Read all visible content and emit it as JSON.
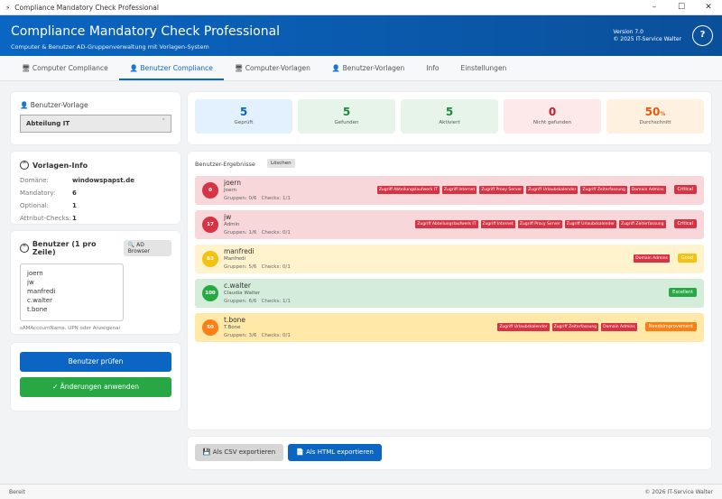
{
  "window": {
    "title": "Compliance Mandatory Check Professional"
  },
  "header": {
    "title": "Compliance Mandatory Check Professional",
    "subtitle": "Computer & Benutzer AD-Gruppenverwaltung mit Vorlagen-System",
    "version": "Version 7.0",
    "copyright": "© 2025 IT-Service Walter",
    "help": "?"
  },
  "tabs": [
    {
      "label": "Computer Compliance",
      "icon": "computer"
    },
    {
      "label": "Benutzer Compliance",
      "icon": "user",
      "active": true
    },
    {
      "label": "Computer-Vorlagen",
      "icon": "computer"
    },
    {
      "label": "Benutzer-Vorlagen",
      "icon": "user"
    },
    {
      "label": "Info"
    },
    {
      "label": "Einstellungen"
    }
  ],
  "left": {
    "template_label": "Benutzer-Vorlage",
    "template_value": "Abteilung IT",
    "info_title": "Vorlagen-Info",
    "info": [
      {
        "k": "Domäne:",
        "v": "windowspapst.de"
      },
      {
        "k": "Mandatory:",
        "v": "6"
      },
      {
        "k": "Optional:",
        "v": "1"
      },
      {
        "k": "Attribut-Checks:",
        "v": "1"
      }
    ],
    "users_title": "Benutzer (1 pro Zeile)",
    "ad_browser": "AD Browser",
    "users_text": "joern\njw\nmanfredi\nc.walter\nt.bone",
    "hint": "sAMAccountName, UPN oder Anzeigenai",
    "check_button": "Benutzer prüfen",
    "apply_button": "✓ Änderungen anwenden"
  },
  "stats": [
    {
      "value": "5",
      "label": "Geprüft",
      "color": "#0a66c2",
      "bg": "#e3f0fd"
    },
    {
      "value": "5",
      "label": "Gefunden",
      "color": "#1e8a3a",
      "bg": "#e6f4ea"
    },
    {
      "value": "5",
      "label": "Aktiviert",
      "color": "#1e8a3a",
      "bg": "#e6f4ea"
    },
    {
      "value": "0",
      "label": "Nicht gefunden",
      "color": "#c81e2d",
      "bg": "#fde8ea"
    },
    {
      "value": "50",
      "unit": "%",
      "label": "Durchschnitt",
      "color": "#e8590c",
      "bg": "#fff1e0"
    }
  ],
  "results": {
    "title": "Benutzer-Ergebnisse",
    "clear": "Löschen",
    "rows": [
      {
        "score": "0",
        "user": "joern",
        "display": "Joern",
        "groups": "Gruppen: 0/6",
        "checks": "Checks: 1/1",
        "missing": [
          "Zugriff Abteilungslaufwerk IT",
          "Zugriff Internet",
          "Zugriff Proxy Server",
          "Zugriff Urlaubskalender",
          "Zugriff Zeiterfassung",
          "Domain Admins"
        ],
        "status": "Critical",
        "bg": "#f8d7da",
        "color": "#d63345"
      },
      {
        "score": "17",
        "user": "jw",
        "display": "Admin",
        "groups": "Gruppen: 1/6",
        "checks": "Checks: 0/1",
        "missing": [
          "Zugriff Abteilungslaufwerk IT",
          "Zugriff Internet",
          "Zugriff Proxy Server",
          "Zugriff Urlaubskalender",
          "Zugriff Zeiterfassung"
        ],
        "status": "Critical",
        "bg": "#f8d7da",
        "color": "#d63345"
      },
      {
        "score": "83",
        "user": "manfredi",
        "display": "Manfredi",
        "groups": "Gruppen: 5/6",
        "checks": "Checks: 0/1",
        "missing": [
          "Domain Admins"
        ],
        "status": "Good",
        "bg": "#fff3cd",
        "color": "#f5c211"
      },
      {
        "score": "100",
        "user": "c.walter",
        "display": "Claudia Walter",
        "groups": "Gruppen: 6/6",
        "checks": "Checks: 1/1",
        "missing": [],
        "status": "Excellent",
        "bg": "#d4edda",
        "color": "#28a745"
      },
      {
        "score": "50",
        "user": "t.bone",
        "display": "T.Bone",
        "groups": "Gruppen: 3/6",
        "checks": "Checks: 0/1",
        "missing": [
          "Zugriff Urlaubskalender",
          "Zugriff Zeiterfassung",
          "Domain Admins"
        ],
        "status": "NeedsImprovement",
        "bg": "#ffe8a8",
        "color": "#fd7e14"
      }
    ]
  },
  "export": {
    "csv": "Als CSV exportieren",
    "html": "Als HTML exportieren"
  },
  "statusbar": {
    "left": "Bereit",
    "right": "© 2026 IT-Service Walter"
  }
}
